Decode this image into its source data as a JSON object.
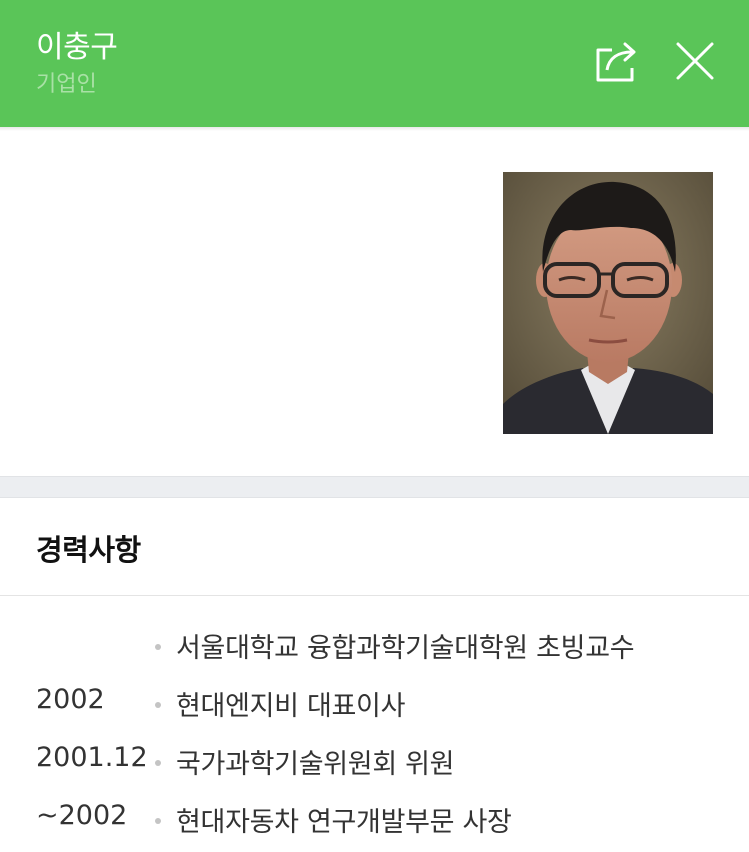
{
  "header": {
    "title": "이충구",
    "subtitle": "기업인",
    "share_icon": "share-icon",
    "close_icon": "close-icon",
    "bg_color": "#5ac558"
  },
  "profile": {
    "photo_icon": "portrait-photo"
  },
  "career": {
    "title": "경력사항",
    "items": [
      {
        "year": "",
        "text": "서울대학교 융합과학기술대학원 초빙교수"
      },
      {
        "year": "2002",
        "text": "현대엔지비 대표이사"
      },
      {
        "year": "2001.12",
        "text": "국가과학기술위원회 위원"
      },
      {
        "year": "~2002",
        "text": "현대자동차 연구개발부문 사장"
      }
    ]
  }
}
